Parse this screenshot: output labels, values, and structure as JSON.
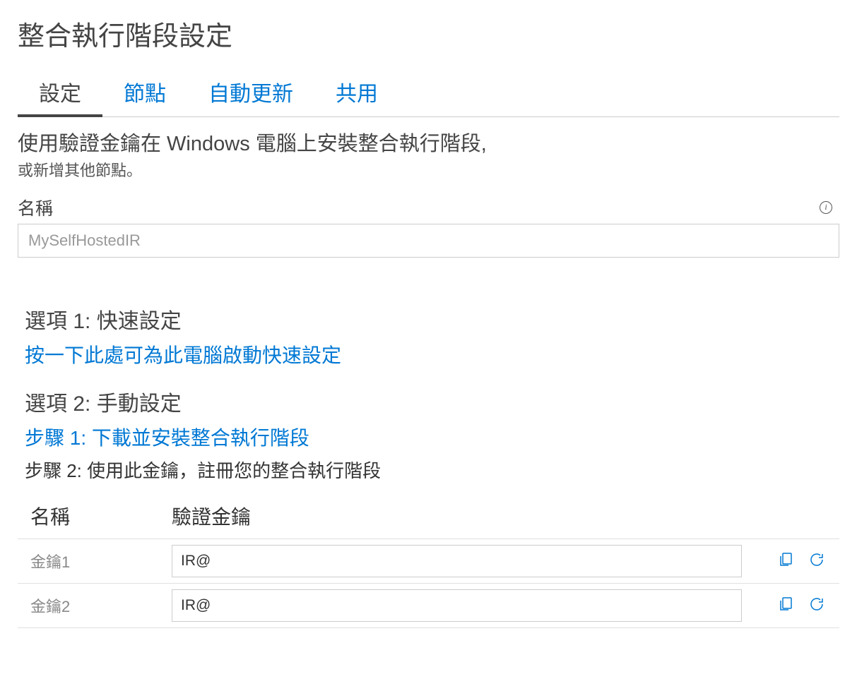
{
  "page_title": "整合執行階段設定",
  "tabs": {
    "settings": "設定",
    "nodes": "節點",
    "auto_update": "自動更新",
    "share": "共用"
  },
  "description_main": "使用驗證金鑰在 Windows 電腦上安裝整合執行階段,",
  "description_sub": "或新增其他節點。",
  "name_label": "名稱",
  "name_value": "MySelfHostedIR",
  "option1": {
    "heading": "選項 1: 快速設定",
    "link": "按一下此處可為此電腦啟動快速設定"
  },
  "option2": {
    "heading": "選項 2: 手動設定",
    "step1_link": "步驟 1: 下載並安裝整合執行階段",
    "step2_text": "步驟 2: 使用此金鑰，註冊您的整合執行階段"
  },
  "keys_table": {
    "header_name": "名稱",
    "header_key": "驗證金鑰",
    "rows": [
      {
        "name": "金鑰1",
        "value": "IR@"
      },
      {
        "name": "金鑰2",
        "value": "IR@"
      }
    ]
  }
}
